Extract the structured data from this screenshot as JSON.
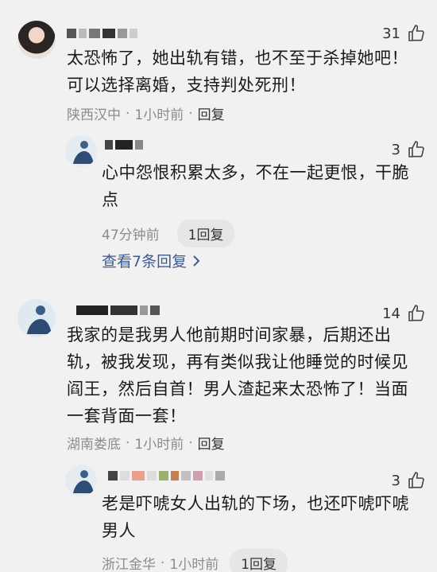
{
  "comments": [
    {
      "likes": "31",
      "text": "太恐怖了，她出轨有错，也不至于杀掉她吧！可以选择离婚，支持判处死刑！",
      "location": "陕西汉中",
      "time": "1小时前",
      "reply_label": "回复",
      "replies": [
        {
          "likes": "3",
          "text": "心中怨恨积累太多，不在一起更恨，干脆点",
          "time": "47分钟前",
          "reply_label": "1回复"
        }
      ],
      "view_more": "查看7条回复"
    },
    {
      "likes": "14",
      "text": "我家的是我男人他前期时间家暴，后期还出轨，被我发现，再有类似我让他睡觉的时候见阎王，然后自首！男人渣起来太恐怖了！当面一套背面一套！",
      "location": "湖南娄底",
      "time": "1小时前",
      "reply_label": "回复",
      "replies": [
        {
          "likes": "3",
          "text": "老是吓唬女人出轨的下场，也还吓唬吓唬男人",
          "location": "浙江金华",
          "time": "1小时前",
          "reply_label": "1回复"
        }
      ]
    }
  ],
  "separator": "·",
  "icons": {
    "like": "thumbs-up-icon",
    "chevron": "chevron-right-icon"
  },
  "colors": {
    "link": "#3d5a8f",
    "meta": "#8c8c8c",
    "background": "#f1f1f1"
  }
}
